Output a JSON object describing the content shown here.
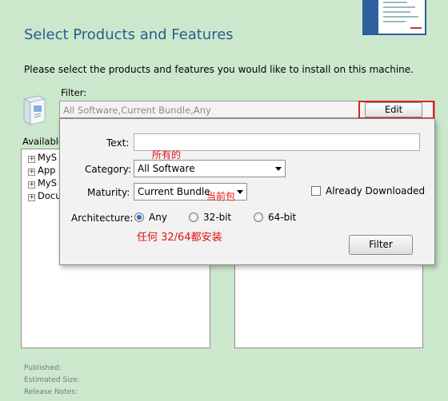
{
  "page": {
    "title": "Select Products and Features",
    "instruction": "Please select the products and features you would like to install on this machine.",
    "filter_label": "Filter:",
    "filter_summary": "All Software,Current Bundle,Any",
    "edit_label": "Edit",
    "available_label": "Available",
    "tree_items": [
      "MyS",
      "App",
      "MyS",
      "Docu"
    ],
    "meta": {
      "published": "Published:",
      "estimated_size": "Estimated Size:",
      "release_notes": "Release Notes:"
    }
  },
  "popup": {
    "text_label": "Text:",
    "text_value": "",
    "category_label": "Category:",
    "category_value": "All Software",
    "maturity_label": "Maturity:",
    "maturity_value": "Current Bundle",
    "already_downloaded_label": "Already Downloaded",
    "already_downloaded_checked": false,
    "architecture_label": "Architecture:",
    "architecture_options": [
      "Any",
      "32-bit",
      "64-bit"
    ],
    "architecture_selected": "Any",
    "filter_button": "Filter"
  },
  "annotations": {
    "text_note": "所有的",
    "maturity_note": "当前包",
    "architecture_note": "任何 32/64都安装"
  },
  "colors": {
    "background": "#cce8cc",
    "title": "#2a5d8f",
    "annotation": "#e01010",
    "highlight": "#e02020"
  }
}
